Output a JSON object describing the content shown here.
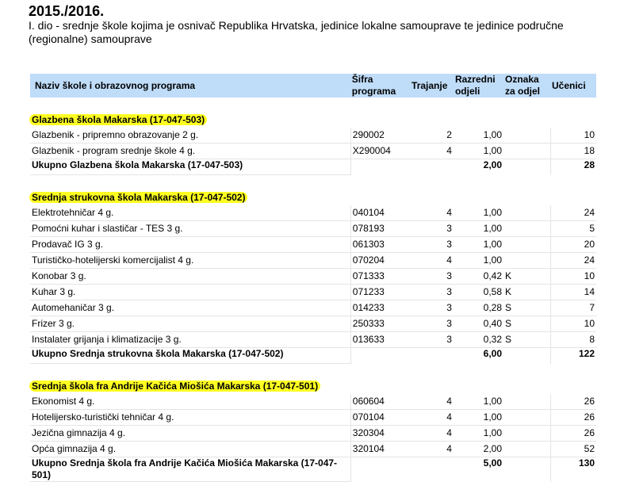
{
  "header": {
    "year": "2015./2016.",
    "description": "I. dio - srednje škole kojima je osnivač Republika Hrvatska, jedinice lokalne samouprave te jedinice područne (regionalne) samouprave"
  },
  "columns": {
    "name": "Naziv škole i obrazovnog programa",
    "code": "Šifra programa",
    "duration": "Trajanje",
    "classes": "Razredni odjeli",
    "mark": "Oznaka za odjel",
    "students": "Učenici"
  },
  "colors": {
    "header_bg": "#bfdcf8",
    "highlight": "#ffff22"
  },
  "schools": [
    {
      "title": "Glazbena škola Makarska (17-047-503)",
      "rows": [
        {
          "name": "Glazbenik - pripremno obrazovanje 2 g.",
          "code": "290002",
          "duration": "2",
          "classes": "1,00",
          "mark": "",
          "students": "10"
        },
        {
          "name": "Glazbenik - program srednje škole 4 g.",
          "code": "X290004",
          "duration": "4",
          "classes": "1,00",
          "mark": "",
          "students": "18"
        }
      ],
      "total": {
        "label": "Ukupno Glazbena škola Makarska (17-047-503)",
        "classes": "2,00",
        "students": "28"
      }
    },
    {
      "title": "Srednja strukovna škola Makarska (17-047-502)",
      "rows": [
        {
          "name": "Elektrotehničar 4 g.",
          "code": "040104",
          "duration": "4",
          "classes": "1,00",
          "mark": "",
          "students": "24"
        },
        {
          "name": "Pomoćni kuhar i slastičar - TES 3 g.",
          "code": "078193",
          "duration": "3",
          "classes": "1,00",
          "mark": "",
          "students": "5"
        },
        {
          "name": "Prodavač IG 3 g.",
          "code": "061303",
          "duration": "3",
          "classes": "1,00",
          "mark": "",
          "students": "20"
        },
        {
          "name": "Turističko-hotelijerski komercijalist 4 g.",
          "code": "070204",
          "duration": "4",
          "classes": "1,00",
          "mark": "",
          "students": "24"
        },
        {
          "name": "Konobar 3 g.",
          "code": "071333",
          "duration": "3",
          "classes": "0,42",
          "mark": "K",
          "students": "10"
        },
        {
          "name": "Kuhar 3 g.",
          "code": "071233",
          "duration": "3",
          "classes": "0,58",
          "mark": "K",
          "students": "14"
        },
        {
          "name": "Automehaničar 3 g.",
          "code": "014233",
          "duration": "3",
          "classes": "0,28",
          "mark": "S",
          "students": "7"
        },
        {
          "name": "Frizer 3 g.",
          "code": "250333",
          "duration": "3",
          "classes": "0,40",
          "mark": "S",
          "students": "10"
        },
        {
          "name": "Instalater grijanja i klimatizacije 3 g.",
          "code": "013633",
          "duration": "3",
          "classes": "0,32",
          "mark": "S",
          "students": "8"
        }
      ],
      "total": {
        "label": "Ukupno Srednja strukovna škola Makarska (17-047-502)",
        "classes": "6,00",
        "students": "122"
      }
    },
    {
      "title": "Srednja škola fra Andrije Kačića Miošića Makarska (17-047-501)",
      "rows": [
        {
          "name": "Ekonomist 4 g.",
          "code": "060604",
          "duration": "4",
          "classes": "1,00",
          "mark": "",
          "students": "26"
        },
        {
          "name": "Hotelijersko-turistički tehničar 4 g.",
          "code": "070104",
          "duration": "4",
          "classes": "1,00",
          "mark": "",
          "students": "26"
        },
        {
          "name": "Jezična gimnazija 4 g.",
          "code": "320304",
          "duration": "4",
          "classes": "1,00",
          "mark": "",
          "students": "26"
        },
        {
          "name": "Opća gimnazija 4 g.",
          "code": "320104",
          "duration": "4",
          "classes": "2,00",
          "mark": "",
          "students": "52"
        }
      ],
      "total": {
        "label": "Ukupno Srednja škola fra Andrije Kačića Miošića Makarska (17-047-501)",
        "classes": "5,00",
        "students": "130"
      }
    }
  ]
}
